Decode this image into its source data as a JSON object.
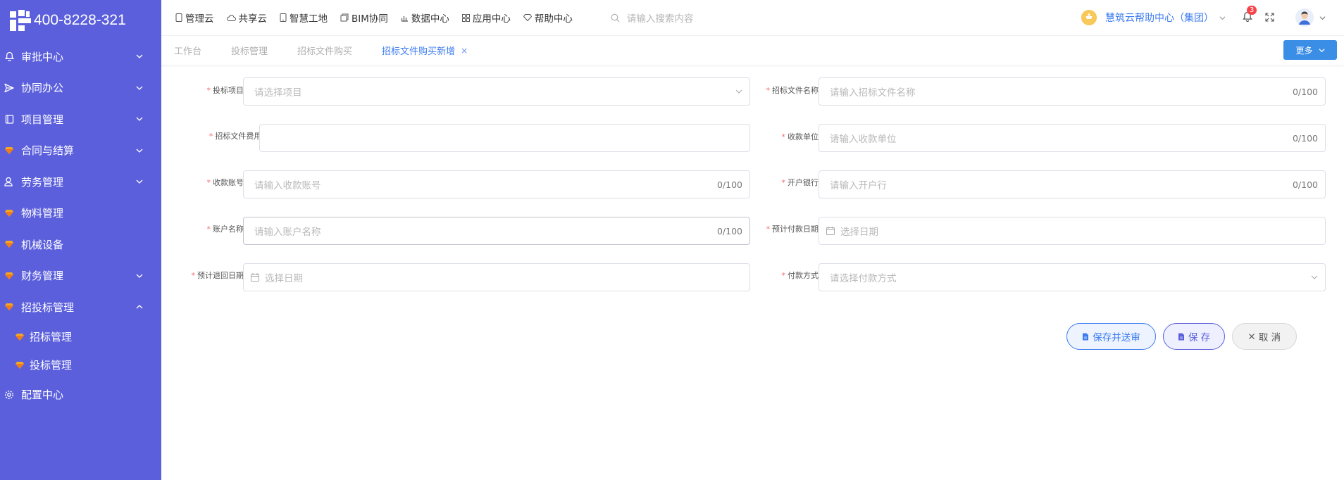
{
  "brand": {
    "phone": "400-8228-321"
  },
  "sidebar": {
    "items": [
      {
        "label": "审批中心",
        "icon": "bell-icon",
        "expandable": true
      },
      {
        "label": "协同办公",
        "icon": "send-icon",
        "expandable": true
      },
      {
        "label": "项目管理",
        "icon": "book-icon",
        "expandable": true
      },
      {
        "label": "合同与结算",
        "icon": "gem-icon",
        "expandable": true
      },
      {
        "label": "劳务管理",
        "icon": "worker-icon",
        "expandable": true
      },
      {
        "label": "物料管理",
        "icon": "gem-icon",
        "expandable": false
      },
      {
        "label": "机械设备",
        "icon": "gem-icon",
        "expandable": false
      },
      {
        "label": "财务管理",
        "icon": "gem-icon",
        "expandable": true
      },
      {
        "label": "招投标管理",
        "icon": "gem-icon",
        "expandable": true,
        "expanded": true
      }
    ],
    "sub_items": [
      {
        "label": "招标管理",
        "icon": "gem-icon"
      },
      {
        "label": "投标管理",
        "icon": "gem-icon"
      }
    ],
    "config": {
      "label": "配置中心",
      "icon": "gear-icon"
    }
  },
  "topnav": {
    "items": [
      {
        "label": "管理云",
        "icon": "phone-icon"
      },
      {
        "label": "共享云",
        "icon": "cloud-icon"
      },
      {
        "label": "智慧工地",
        "icon": "tablet-icon"
      },
      {
        "label": "BIM协同",
        "icon": "cube-icon"
      },
      {
        "label": "数据中心",
        "icon": "bar-chart-icon"
      },
      {
        "label": "应用中心",
        "icon": "grid-icon"
      },
      {
        "label": "帮助中心",
        "icon": "diamond-icon"
      }
    ],
    "search_placeholder": "请输入搜索内容",
    "help_center": "慧筑云帮助中心（集团）",
    "notification_count": "3"
  },
  "tabs": {
    "items": [
      {
        "label": "工作台",
        "active": false
      },
      {
        "label": "投标管理",
        "active": false
      },
      {
        "label": "招标文件购买",
        "active": false
      },
      {
        "label": "招标文件购买新增",
        "active": true,
        "closable": true
      }
    ],
    "close_glyph": "×",
    "more_label": "更多"
  },
  "form": {
    "required_mark": "*",
    "project": {
      "label": "投标项目",
      "placeholder": "请选择项目"
    },
    "doc_name": {
      "label": "招标文件名称",
      "placeholder": "请输入招标文件名称",
      "count": "0/100"
    },
    "doc_fee": {
      "label": "招标文件费用(元)",
      "placeholder": ""
    },
    "payee_unit": {
      "label": "收款单位",
      "placeholder": "请输入收款单位",
      "count": "0/100"
    },
    "payee_account": {
      "label": "收款账号",
      "placeholder": "请输入收款账号",
      "count": "0/100"
    },
    "bank": {
      "label": "开户银行",
      "placeholder": "请输入开户行",
      "count": "0/100"
    },
    "account_name": {
      "label": "账户名称",
      "placeholder": "请输入账户名称",
      "count": "0/100"
    },
    "expected_pay_date": {
      "label": "预计付款日期",
      "placeholder": "选择日期"
    },
    "expected_refund_date": {
      "label": "预计退回日期",
      "placeholder": "选择日期"
    },
    "pay_method": {
      "label": "付款方式",
      "placeholder": "请选择付款方式"
    }
  },
  "actions": {
    "save_submit": "保存并送审",
    "save": "保 存",
    "cancel": "取 消"
  },
  "colors": {
    "sidebar_bg": "#5b5fdc",
    "accent_blue": "#3c7bf0",
    "required_red": "#f56c6c",
    "badge_red": "#f5454a"
  }
}
